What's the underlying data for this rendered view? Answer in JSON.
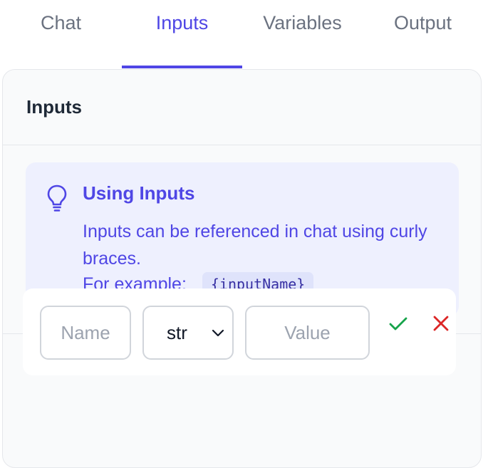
{
  "tabs": {
    "chat": "Chat",
    "inputs": "Inputs",
    "variables": "Variables",
    "output": "Output",
    "active": "Inputs"
  },
  "panel": {
    "title": "Inputs"
  },
  "info": {
    "icon": "lightbulb-icon",
    "title": "Using Inputs",
    "text": "Inputs can be referenced in chat using curly braces.",
    "example_label": "For example:",
    "example_code": "{inputName}"
  },
  "new_input": {
    "name_placeholder": "Name",
    "type_value": "str",
    "value_placeholder": "Value",
    "confirm_icon": "check-icon",
    "cancel_icon": "close-icon"
  },
  "colors": {
    "accent": "#4f46e5",
    "confirm": "#16a34a",
    "cancel": "#dc2626"
  }
}
